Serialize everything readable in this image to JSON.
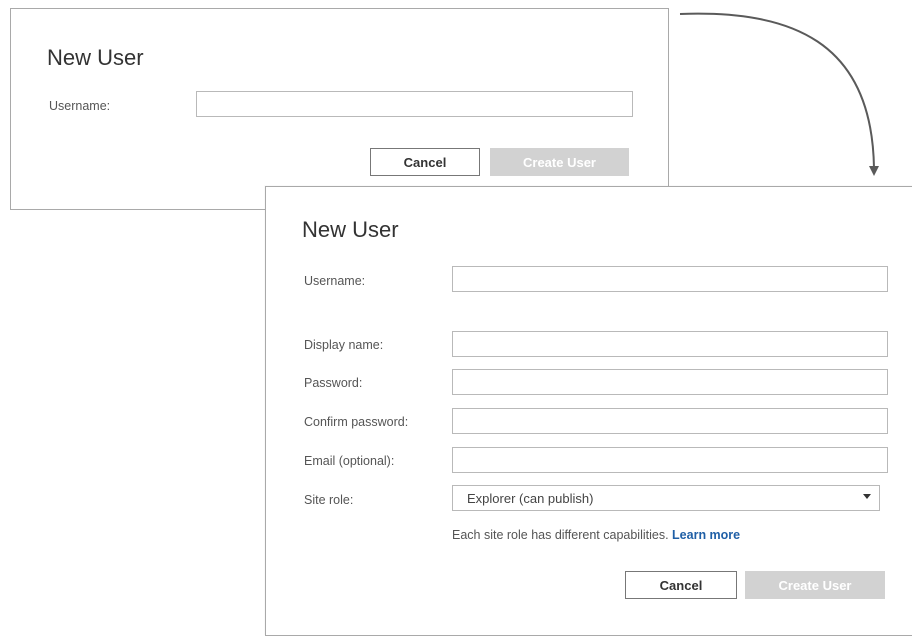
{
  "dialog_small": {
    "title": "New User",
    "username_label": "Username:",
    "username_value": "",
    "cancel_label": "Cancel",
    "create_label": "Create User"
  },
  "dialog_large": {
    "title": "New User",
    "username_label": "Username:",
    "username_value": "",
    "display_name_label": "Display name:",
    "display_name_value": "",
    "password_label": "Password:",
    "password_value": "",
    "confirm_password_label": "Confirm password:",
    "confirm_password_value": "",
    "email_label": "Email (optional):",
    "email_value": "",
    "site_role_label": "Site role:",
    "site_role_value": "Explorer (can publish)",
    "site_role_hint": "Each site role has different capabilities.",
    "learn_more_label": "Learn more",
    "cancel_label": "Cancel",
    "create_label": "Create User"
  },
  "colors": {
    "link": "#1f5fa6",
    "disabled_button": "#d2d2d2",
    "border": "#b9b9b9",
    "arrow": "#555555"
  },
  "icons": {
    "flow": "curved-arrow-icon",
    "dropdown": "caret-down-icon"
  }
}
